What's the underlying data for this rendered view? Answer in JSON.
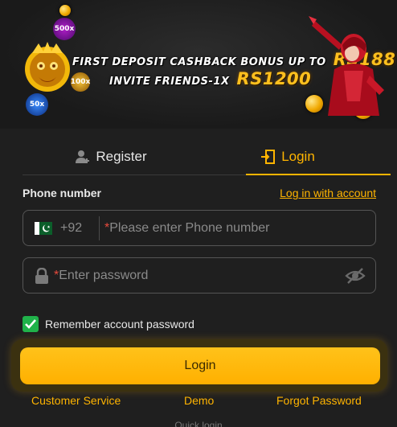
{
  "banner": {
    "line1_text": "FIRST DEPOSIT CASHBACK BONUS UP TO",
    "line1_amount": "RS188",
    "line2_text": "INVITE FRIENDS-1X",
    "line2_amount": "RS1200",
    "chip_labels": [
      "500x",
      "100x",
      "50x"
    ]
  },
  "tabs": [
    {
      "label": "Register",
      "icon": "add-user-icon",
      "active": false
    },
    {
      "label": "Login",
      "icon": "door-login-icon",
      "active": true
    }
  ],
  "form": {
    "phone_label": "Phone number",
    "account_link": "Log in with account",
    "country_code": "+92",
    "phone_required_mark": "*",
    "phone_placeholder": "Please enter Phone number",
    "password_required_mark": "*",
    "password_placeholder": "Enter password",
    "remember_label": "Remember account password",
    "remember_checked": true
  },
  "login_button": "Login",
  "footer": {
    "customer_service": "Customer Service",
    "demo": "Demo",
    "forgot_password": "Forgot Password",
    "quick_login": "Quick login"
  },
  "colors": {
    "accent": "#ffb400",
    "background": "#1f1f1f",
    "checkbox": "#20b24a",
    "required": "#e84a3c"
  }
}
